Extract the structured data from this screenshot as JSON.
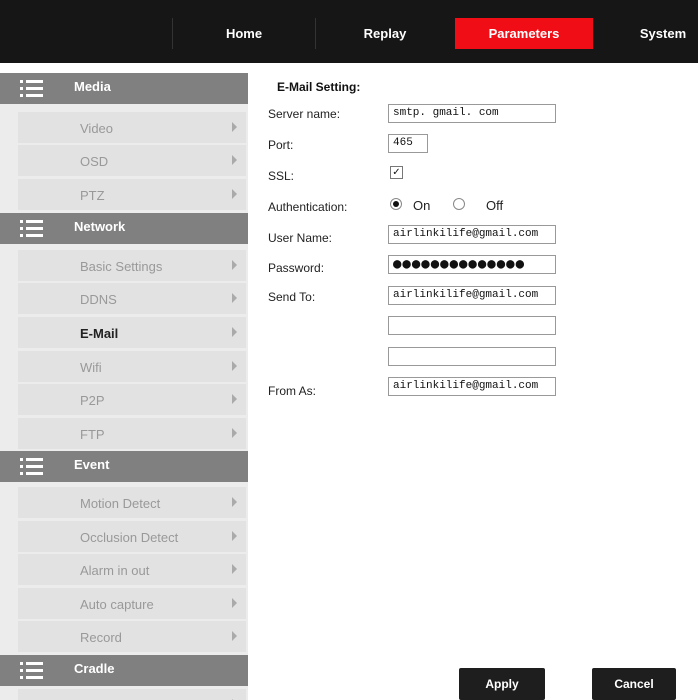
{
  "topbar": {
    "tabs": [
      {
        "label": "Home",
        "active": false
      },
      {
        "label": "Replay",
        "active": false
      },
      {
        "label": "Parameters",
        "active": true
      },
      {
        "label": "System",
        "active": false
      }
    ]
  },
  "sidebar": {
    "sections": [
      {
        "title": "Media",
        "items": [
          "Video",
          "OSD",
          "PTZ"
        ]
      },
      {
        "title": "Network",
        "items": [
          "Basic Settings",
          "DDNS",
          "E-Mail",
          "Wifi",
          "P2P",
          "FTP"
        ]
      },
      {
        "title": "Event",
        "items": [
          "Motion Detect",
          "Occlusion Detect",
          "Alarm in out",
          "Auto capture",
          "Record"
        ]
      },
      {
        "title": "Cradle",
        "items": [
          ""
        ]
      }
    ],
    "active_item": "E-Mail"
  },
  "form": {
    "heading": "E-Mail Setting:",
    "server_label": "Server name:",
    "server_value": "smtp. gmail. com",
    "port_label": "Port:",
    "port_value": "465",
    "ssl_label": "SSL:",
    "ssl_checked": true,
    "auth_label": "Authentication:",
    "auth_on": "On",
    "auth_off": "Off",
    "username_label": "User Name:",
    "username_value": "airlinkilife@gmail.com",
    "password_label": "Password:",
    "password_value": "●●●●●●●●●●●●●●",
    "sendto_label": "Send To:",
    "sendto_value_1": "airlinkilife@gmail.com",
    "sendto_value_2": "",
    "sendto_value_3": "",
    "from_label": "From As:",
    "from_value": "airlinkilife@gmail.com"
  },
  "buttons": {
    "apply": "Apply",
    "cancel": "Cancel"
  },
  "colors": {
    "topbar": "#161616",
    "active_tab": "#f10d15",
    "section": "#808080",
    "sidebar_bg": "#ececec",
    "item_bg": "#e2e2e2"
  }
}
